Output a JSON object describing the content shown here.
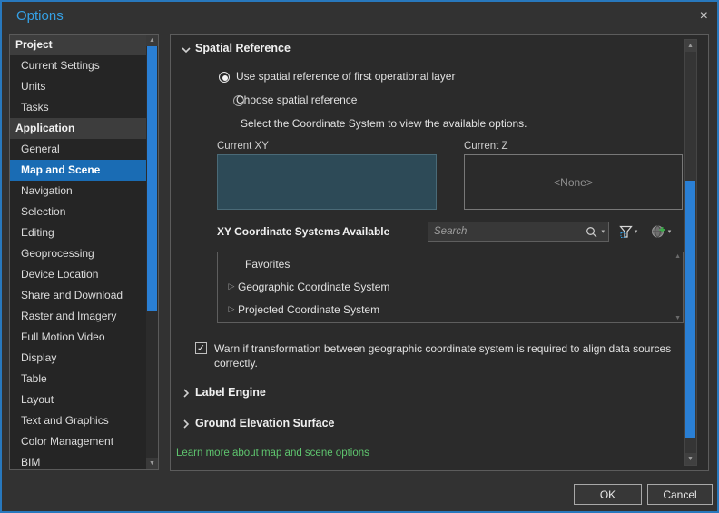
{
  "window": {
    "title": "Options",
    "close_glyph": "×"
  },
  "colors": {
    "title_accent": "#35a0e4",
    "window_border": "#2878bd",
    "selection_blue": "#1a6cb4",
    "scrollbar_thumb": "#2a7fd4",
    "link_green": "#5ec46e",
    "current_xy_fill": "#2d4a57"
  },
  "icons": {
    "scroll_up": "▲",
    "scroll_down": "▼",
    "tree_expander": "▷",
    "dropdown_caret": "▾",
    "checkmark": "✓"
  },
  "sidebar": {
    "selected": "Map and Scene",
    "groups": [
      {
        "header": "Project",
        "items": [
          {
            "label": "Current Settings"
          },
          {
            "label": "Units"
          },
          {
            "label": "Tasks"
          }
        ]
      },
      {
        "header": "Application",
        "items": [
          {
            "label": "General"
          },
          {
            "label": "Map and Scene"
          },
          {
            "label": "Navigation"
          },
          {
            "label": "Selection"
          },
          {
            "label": "Editing"
          },
          {
            "label": "Geoprocessing"
          },
          {
            "label": "Device Location"
          },
          {
            "label": "Share and Download"
          },
          {
            "label": "Raster and Imagery"
          },
          {
            "label": "Full Motion Video"
          },
          {
            "label": "Display"
          },
          {
            "label": "Table"
          },
          {
            "label": "Layout"
          },
          {
            "label": "Text and Graphics"
          },
          {
            "label": "Color Management"
          },
          {
            "label": "BIM"
          }
        ]
      }
    ]
  },
  "main": {
    "spatial_reference": {
      "title": "Spatial Reference",
      "radio_first_layer": "Use spatial reference of first operational layer",
      "radio_choose": "Choose spatial reference",
      "hint": "Select the Coordinate System to view the available options.",
      "current_xy_label": "Current XY",
      "current_z_label": "Current Z",
      "current_z_value": "<None>",
      "xy_available_label": "XY Coordinate Systems Available",
      "search_placeholder": "Search",
      "list_items": [
        {
          "label": "Favorites"
        },
        {
          "label": "Geographic Coordinate System"
        },
        {
          "label": "Projected Coordinate System"
        }
      ],
      "warn_text": "Warn if transformation between geographic coordinate system is required to align data sources correctly.",
      "warn_checked": true
    },
    "collapsed_sections": [
      {
        "title": "Label Engine"
      },
      {
        "title": "Ground Elevation Surface"
      }
    ],
    "learn_more": "Learn more about map and scene options"
  },
  "footer": {
    "ok_label": "OK",
    "cancel_label": "Cancel"
  }
}
